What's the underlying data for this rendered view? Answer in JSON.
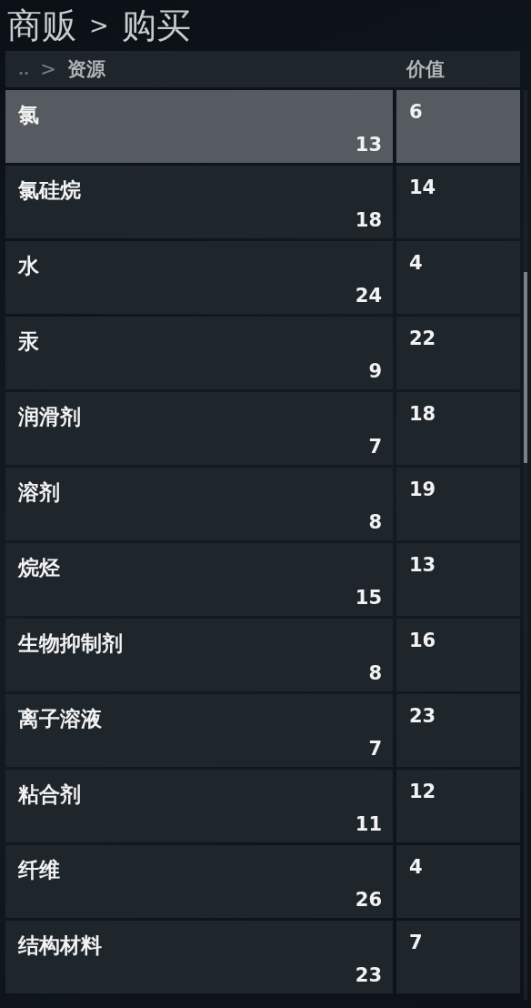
{
  "title": {
    "section": "商贩",
    "separator": ">",
    "page": "购买"
  },
  "header": {
    "up": "..",
    "separator": ">",
    "category": "资源",
    "value_column": "价值"
  },
  "rows": [
    {
      "name": "氯",
      "quantity": "13",
      "value": "6",
      "selected": true
    },
    {
      "name": "氯硅烷",
      "quantity": "18",
      "value": "14",
      "selected": false
    },
    {
      "name": "水",
      "quantity": "24",
      "value": "4",
      "selected": false
    },
    {
      "name": "汞",
      "quantity": "9",
      "value": "22",
      "selected": false
    },
    {
      "name": "润滑剂",
      "quantity": "7",
      "value": "18",
      "selected": false
    },
    {
      "name": "溶剂",
      "quantity": "8",
      "value": "19",
      "selected": false
    },
    {
      "name": "烷烃",
      "quantity": "15",
      "value": "13",
      "selected": false
    },
    {
      "name": "生物抑制剂",
      "quantity": "8",
      "value": "16",
      "selected": false
    },
    {
      "name": "离子溶液",
      "quantity": "7",
      "value": "23",
      "selected": false
    },
    {
      "name": "粘合剂",
      "quantity": "11",
      "value": "12",
      "selected": false
    },
    {
      "name": "纤维",
      "quantity": "26",
      "value": "4",
      "selected": false
    },
    {
      "name": "结构材料",
      "quantity": "23",
      "value": "7",
      "selected": false
    }
  ]
}
